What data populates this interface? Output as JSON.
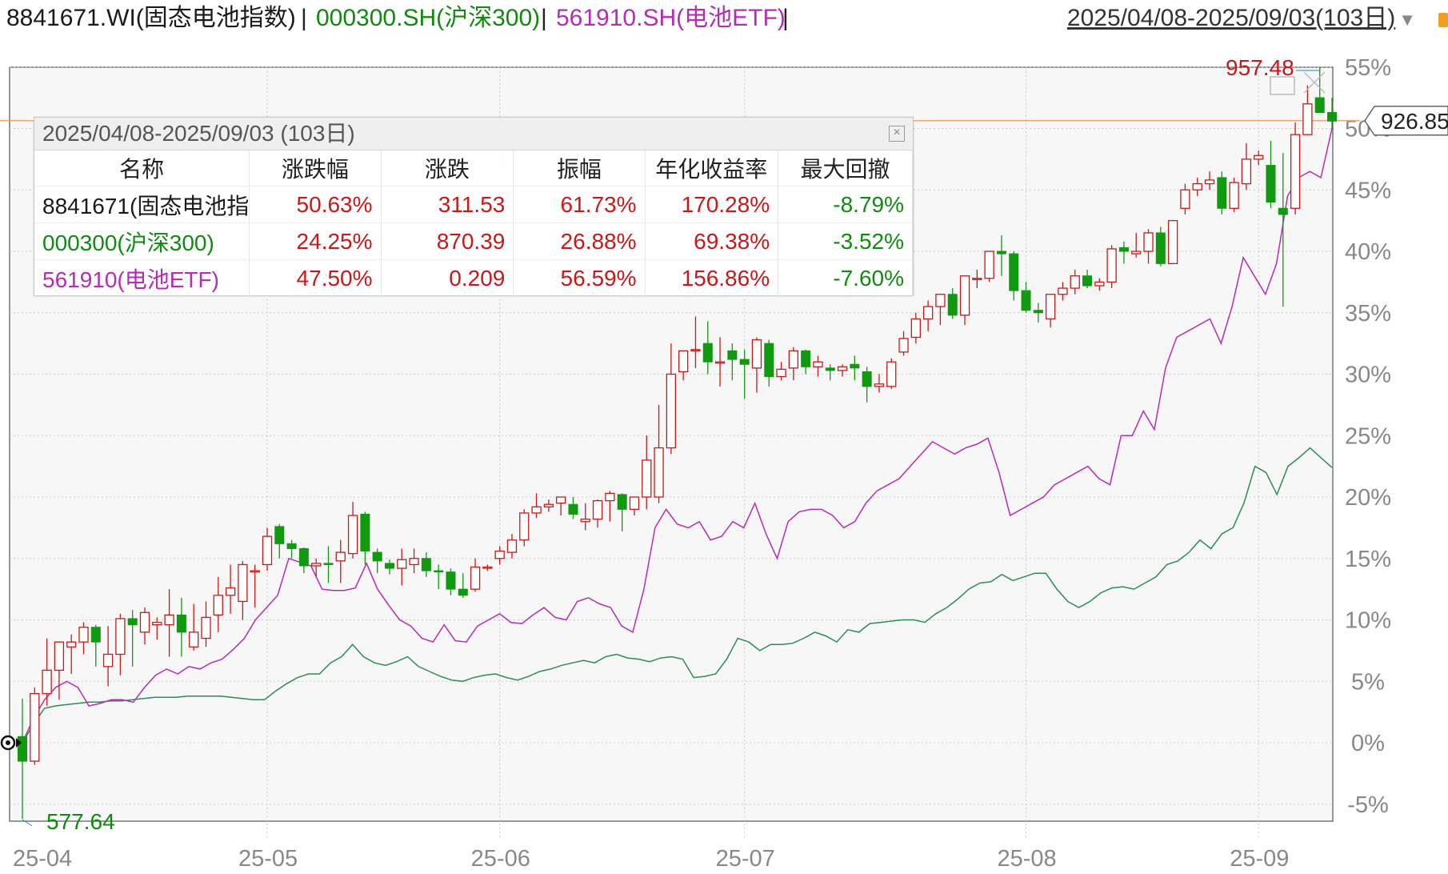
{
  "header": {
    "series": [
      {
        "label": "8841671.WI(固态电池指数)",
        "color": "#1a1a1a"
      },
      {
        "label": "000300.SH(沪深300)",
        "color": "#118a11"
      },
      {
        "label": "561910.SH(电池ETF)",
        "color": "#b52cb5"
      }
    ],
    "separator": "|",
    "range": "2025/04/08-2025/09/03(103日)"
  },
  "stats": {
    "title": "2025/04/08-2025/09/03 (103日)",
    "columns": [
      "名称",
      "涨跌幅",
      "涨跌",
      "振幅",
      "年化收益率",
      "最大回撤"
    ],
    "rows": [
      {
        "name": "8841671(固态电池指",
        "color": "#1a1a1a",
        "pct": "50.63%",
        "chg": "311.53",
        "amp": "61.73%",
        "annual": "170.28%",
        "mdd": "-8.79%"
      },
      {
        "name": "000300(沪深300)",
        "color": "#118a11",
        "pct": "24.25%",
        "chg": "870.39",
        "amp": "26.88%",
        "annual": "69.38%",
        "mdd": "-3.52%"
      },
      {
        "name": "561910(电池ETF)",
        "color": "#b52cb5",
        "pct": "47.50%",
        "chg": "0.209",
        "amp": "56.59%",
        "annual": "156.86%",
        "mdd": "-7.60%"
      }
    ]
  },
  "chart_data": {
    "type": "line",
    "y_axis": {
      "unit": "%",
      "ticks": [
        55,
        50,
        45,
        40,
        35,
        30,
        25,
        20,
        15,
        10,
        5,
        0,
        -5
      ],
      "labels_shown": [
        "55%",
        "50%",
        "45%",
        "40%",
        "35%",
        "30%",
        "25%",
        "20%",
        "15%",
        "10%",
        "5%",
        "0%",
        "-5%"
      ],
      "range": [
        -6.5,
        55
      ]
    },
    "x_axis": {
      "labels": [
        "25-04",
        "25-05",
        "25-06",
        "25-07",
        "25-08",
        "25-09"
      ]
    },
    "grid": true,
    "annotations": {
      "high": "957.48",
      "low": "577.64",
      "last": "926.85",
      "last_pct": 50.63
    },
    "colors": {
      "up": "#c81919",
      "down": "#119911",
      "hs300": "#2e8b57",
      "etf": "#b52cb5",
      "lastline": "#e8a060"
    },
    "candles": [
      [
        0.5,
        3.6,
        -6.2,
        -1.5
      ],
      [
        -1.5,
        4.5,
        -1.8,
        4.0
      ],
      [
        4.0,
        8.5,
        3.0,
        5.9
      ],
      [
        5.9,
        8.2,
        3.5,
        8.2
      ],
      [
        7.8,
        8.8,
        5.6,
        8.2
      ],
      [
        8.2,
        9.8,
        7.2,
        9.4
      ],
      [
        9.4,
        9.6,
        6.2,
        8.2
      ],
      [
        6.2,
        9.5,
        4.6,
        7.2
      ],
      [
        7.2,
        10.5,
        5.5,
        10.1
      ],
      [
        10.1,
        10.8,
        6.2,
        9.6
      ],
      [
        9.0,
        11.0,
        8.0,
        10.6
      ],
      [
        9.6,
        10.2,
        8.4,
        9.8
      ],
      [
        9.6,
        12.5,
        7.0,
        10.4
      ],
      [
        10.4,
        11.8,
        7.0,
        9.0
      ],
      [
        7.8,
        11.3,
        7.5,
        9.0
      ],
      [
        8.5,
        11.5,
        7.8,
        10.2
      ],
      [
        10.4,
        13.5,
        9.0,
        12.0
      ],
      [
        12.0,
        14.5,
        10.5,
        12.6
      ],
      [
        11.5,
        14.8,
        10.0,
        14.5
      ],
      [
        14.0,
        14.5,
        11.0,
        14.0
      ],
      [
        14.5,
        17.5,
        14.0,
        16.8
      ],
      [
        17.6,
        17.8,
        15.0,
        16.2
      ],
      [
        16.2,
        16.5,
        15.0,
        15.8
      ],
      [
        15.8,
        15.9,
        13.8,
        14.4
      ],
      [
        14.4,
        15.0,
        13.5,
        14.6
      ],
      [
        14.6,
        16.0,
        13.0,
        14.5
      ],
      [
        14.8,
        16.5,
        13.0,
        15.5
      ],
      [
        15.4,
        19.6,
        15.0,
        18.5
      ],
      [
        18.6,
        18.8,
        14.5,
        15.6
      ],
      [
        15.5,
        15.8,
        13.8,
        14.8
      ],
      [
        14.6,
        14.9,
        13.7,
        14.2
      ],
      [
        14.2,
        15.8,
        12.8,
        14.9
      ],
      [
        14.5,
        15.8,
        13.8,
        15.0
      ],
      [
        15.0,
        15.5,
        13.5,
        14.0
      ],
      [
        14.0,
        14.5,
        12.5,
        13.9
      ],
      [
        13.9,
        14.2,
        12.0,
        12.5
      ],
      [
        12.5,
        13.8,
        11.8,
        12.0
      ],
      [
        12.5,
        15.0,
        12.3,
        14.3
      ],
      [
        14.3,
        14.5,
        14.0,
        14.3
      ],
      [
        15.0,
        16.0,
        14.5,
        15.6
      ],
      [
        15.5,
        17.0,
        15.0,
        16.5
      ],
      [
        16.5,
        19.0,
        16.0,
        18.7
      ],
      [
        18.7,
        20.3,
        18.3,
        19.2
      ],
      [
        19.2,
        19.8,
        18.8,
        19.4
      ],
      [
        19.5,
        20.0,
        18.5,
        20.0
      ],
      [
        19.4,
        20.0,
        18.2,
        18.6
      ],
      [
        18.0,
        19.5,
        17.3,
        18.2
      ],
      [
        18.2,
        19.8,
        17.5,
        19.7
      ],
      [
        19.7,
        20.5,
        18.0,
        20.3
      ],
      [
        20.2,
        20.3,
        17.2,
        19.0
      ],
      [
        19.0,
        20.0,
        18.5,
        20.0
      ],
      [
        20.0,
        25.0,
        19.0,
        23.0
      ],
      [
        20.0,
        27.5,
        19.5,
        24.0
      ],
      [
        24.0,
        32.5,
        23.5,
        30.0
      ],
      [
        30.2,
        31.5,
        29.5,
        31.9
      ],
      [
        31.9,
        34.7,
        30.5,
        32.0
      ],
      [
        32.5,
        34.3,
        30.0,
        31.0
      ],
      [
        31.0,
        33.0,
        29.0,
        31.0
      ],
      [
        31.9,
        32.5,
        29.5,
        31.2
      ],
      [
        31.2,
        32.0,
        28.0,
        30.8
      ],
      [
        30.5,
        33.0,
        28.5,
        32.8
      ],
      [
        32.5,
        32.8,
        29.0,
        29.8
      ],
      [
        29.8,
        31.0,
        29.5,
        30.4
      ],
      [
        30.5,
        32.2,
        29.5,
        31.9
      ],
      [
        31.9,
        32.0,
        30.0,
        30.6
      ],
      [
        30.6,
        31.5,
        29.8,
        31.0
      ],
      [
        30.5,
        30.8,
        29.5,
        30.3
      ],
      [
        30.3,
        30.8,
        29.8,
        30.6
      ],
      [
        30.8,
        31.5,
        29.5,
        30.5
      ],
      [
        30.2,
        30.6,
        27.7,
        29.0
      ],
      [
        29.0,
        30.0,
        28.5,
        29.2
      ],
      [
        29.0,
        31.3,
        28.8,
        31.0
      ],
      [
        31.8,
        33.5,
        31.5,
        32.9
      ],
      [
        33.0,
        35.0,
        32.5,
        34.5
      ],
      [
        34.5,
        36.0,
        33.5,
        35.5
      ],
      [
        35.5,
        36.5,
        34.0,
        36.5
      ],
      [
        36.5,
        37.0,
        34.5,
        34.8
      ],
      [
        34.8,
        38.0,
        34.0,
        38.0
      ],
      [
        37.8,
        38.5,
        37.0,
        37.8
      ],
      [
        37.8,
        40.0,
        37.5,
        40.0
      ],
      [
        40.0,
        41.3,
        38.0,
        39.8
      ],
      [
        39.8,
        40.0,
        36.0,
        36.8
      ],
      [
        36.8,
        37.5,
        35.0,
        35.2
      ],
      [
        35.2,
        35.8,
        34.2,
        35.0
      ],
      [
        34.5,
        36.5,
        33.8,
        36.5
      ],
      [
        36.5,
        37.5,
        36.0,
        37.0
      ],
      [
        37.0,
        38.5,
        36.5,
        38.0
      ],
      [
        38.0,
        38.5,
        37.0,
        37.2
      ],
      [
        37.2,
        37.8,
        36.8,
        37.5
      ],
      [
        37.5,
        40.5,
        37.0,
        40.2
      ],
      [
        40.3,
        40.8,
        39.0,
        40.0
      ],
      [
        39.8,
        41.5,
        39.5,
        40.0
      ],
      [
        40.0,
        41.8,
        39.0,
        41.5
      ],
      [
        41.5,
        42.0,
        38.8,
        39.0
      ],
      [
        39.0,
        42.5,
        39.0,
        42.5
      ],
      [
        43.5,
        45.5,
        43.0,
        45.0
      ],
      [
        45.0,
        46.0,
        44.5,
        45.5
      ],
      [
        45.5,
        46.5,
        45.0,
        45.8
      ],
      [
        46.0,
        46.5,
        43.0,
        43.5
      ],
      [
        43.5,
        46.0,
        43.2,
        45.6
      ],
      [
        45.5,
        48.8,
        45.0,
        47.5
      ],
      [
        47.5,
        48.2,
        47.0,
        47.8
      ],
      [
        47.0,
        49.0,
        43.5,
        44.0
      ],
      [
        43.5,
        48.0,
        35.5,
        43.0
      ],
      [
        43.5,
        50.5,
        43.0,
        49.5
      ],
      [
        49.5,
        53.5,
        49.5,
        52.0
      ],
      [
        52.5,
        55.0,
        51.5,
        51.3
      ],
      [
        51.3,
        52.5,
        50.0,
        50.6
      ]
    ],
    "series": [
      {
        "name": "000300.SH(沪深300)",
        "values": [
          0.0,
          1.5,
          2.8,
          3.0,
          3.1,
          3.2,
          3.3,
          3.3,
          3.4,
          3.4,
          3.5,
          3.6,
          3.7,
          3.7,
          3.7,
          3.8,
          3.8,
          3.8,
          3.8,
          3.7,
          3.6,
          3.5,
          3.5,
          4.2,
          4.8,
          5.3,
          5.6,
          5.6,
          6.5,
          7.0,
          8.0,
          7.0,
          6.5,
          6.3,
          6.6,
          7.0,
          6.2,
          5.8,
          5.4,
          5.1,
          5.0,
          5.3,
          5.5,
          5.6,
          5.3,
          5.1,
          5.4,
          5.8,
          6.0,
          6.3,
          6.5,
          6.7,
          6.5,
          7.0,
          7.2,
          6.9,
          6.8,
          6.6,
          6.9,
          7.0,
          6.8,
          5.3,
          5.4,
          5.6,
          6.8,
          8.5,
          8.2,
          7.5,
          8.0,
          8.0,
          8.1,
          8.5,
          9.0,
          8.7,
          8.2,
          9.2,
          9.0,
          9.7,
          9.8,
          9.9,
          10.0,
          10.0,
          9.8,
          10.5,
          11.0,
          11.7,
          12.5,
          13.0,
          13.1,
          13.7,
          13.2,
          13.5,
          13.8,
          13.8,
          12.5,
          11.5,
          11.0,
          11.5,
          12.2,
          12.6,
          12.7,
          12.5,
          13.0,
          13.5,
          14.5,
          14.8,
          15.5,
          16.5,
          15.8,
          17.0,
          17.5,
          19.5,
          22.5,
          22.0,
          20.2,
          22.5,
          23.2,
          24.0,
          23.2,
          22.4
        ]
      },
      {
        "name": "561910.SH(电池ETF)",
        "values": [
          0.0,
          2.0,
          3.5,
          4.5,
          5.0,
          4.5,
          3.0,
          3.2,
          3.5,
          3.5,
          3.3,
          4.5,
          5.5,
          6.0,
          5.6,
          6.2,
          6.0,
          6.5,
          6.8,
          7.6,
          8.5,
          10.0,
          11.0,
          12.0,
          15.0,
          14.7,
          14.4,
          12.5,
          12.4,
          12.4,
          12.6,
          14.6,
          12.5,
          11.2,
          10.0,
          9.5,
          8.5,
          8.2,
          9.6,
          8.3,
          8.2,
          9.5,
          10.0,
          10.5,
          9.8,
          9.7,
          10.4,
          11.0,
          10.2,
          10.0,
          11.5,
          11.8,
          11.3,
          11.0,
          9.5,
          9.0,
          12.5,
          17.5,
          19.0,
          17.8,
          17.5,
          18.0,
          16.5,
          16.8,
          18.0,
          17.5,
          19.5,
          17.0,
          15.0,
          18.0,
          18.8,
          19.0,
          19.0,
          18.5,
          17.5,
          18.0,
          19.5,
          20.5,
          21.0,
          21.5,
          22.5,
          23.5,
          24.5,
          24.0,
          23.5,
          24.0,
          24.3,
          24.8,
          22.0,
          18.5,
          19.0,
          19.5,
          20.0,
          21.0,
          21.5,
          22.0,
          22.5,
          21.5,
          21.0,
          25.0,
          25.0,
          27.0,
          25.5,
          30.5,
          33.0,
          33.5,
          34.0,
          34.5,
          32.5,
          35.5,
          39.5,
          38.0,
          36.5,
          39.0,
          44.5,
          46.0,
          46.5,
          46.0,
          50.0
        ]
      }
    ]
  }
}
